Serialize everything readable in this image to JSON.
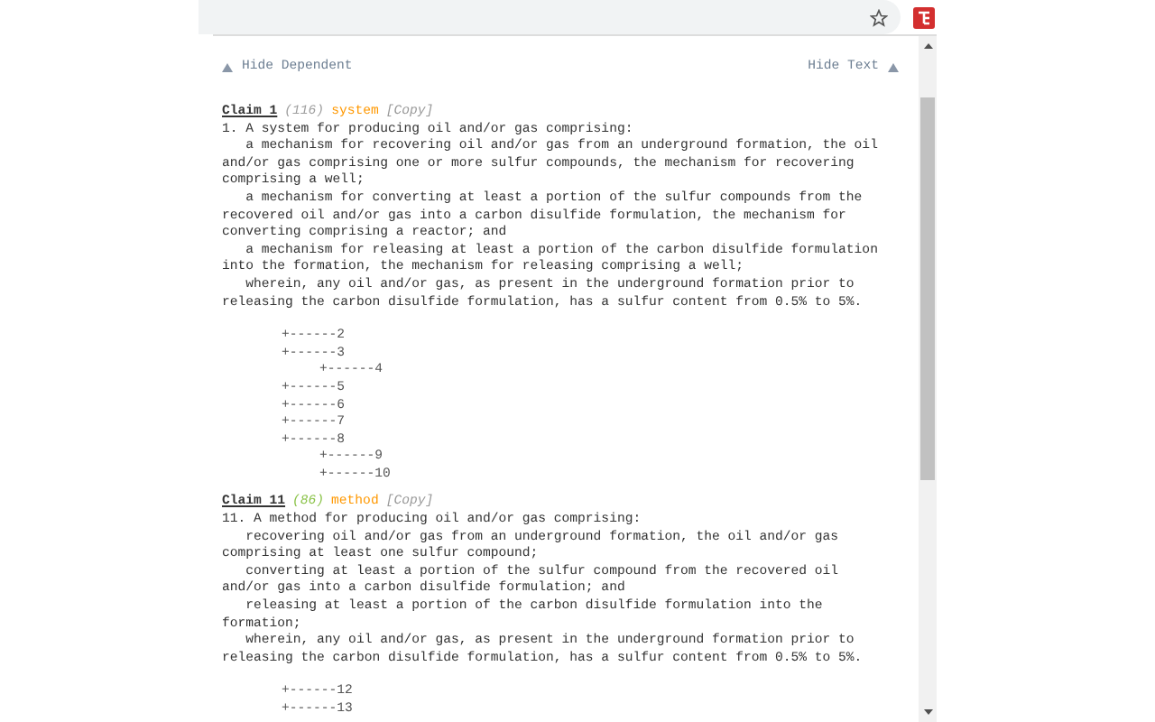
{
  "toolbar": {
    "left_toggle": "Hide Dependent",
    "right_toggle": "Hide Text"
  },
  "claims": [
    {
      "title": "Claim 1",
      "count": "(116)",
      "color": "#9e9e9e",
      "type": "system",
      "copy": "[Copy]",
      "paragraphs": [
        [
          "1. A system for producing oil and/or gas comprising:"
        ],
        [
          "   a mechanism for recovering oil and/or gas from an underground formation, the oil",
          "and/or gas comprising one or more sulfur compounds, the mechanism for recovering",
          "comprising a well;"
        ],
        [
          "   a mechanism for converting at least a portion of the sulfur compounds from the",
          "recovered oil and/or gas into a carbon disulfide formulation, the mechanism for",
          "converting comprising a reactor; and"
        ],
        [
          "   a mechanism for releasing at least a portion of the carbon disulfide formulation",
          "into the formation, the mechanism for releasing comprising a well;"
        ],
        [
          "   wherein, any oil and/or gas, as present in the underground formation prior to",
          "releasing the carbon disulfide formulation, has a sulfur content from 0.5% to 5%."
        ]
      ],
      "tree": [
        {
          "label": "+------2"
        },
        {
          "label": "+------3",
          "children": [
            {
              "label": "+------4"
            }
          ]
        },
        {
          "label": "+------5"
        },
        {
          "label": "+------6"
        },
        {
          "label": "+------7"
        },
        {
          "label": "+------8",
          "children": [
            {
              "label": "+------9"
            },
            {
              "label": "+------10"
            }
          ]
        }
      ]
    },
    {
      "title": "Claim 11",
      "count": "(86)",
      "color": "#8bc34a",
      "type": "method",
      "copy": "[Copy]",
      "paragraphs": [
        [
          "11. A method for producing oil and/or gas comprising:"
        ],
        [
          "   recovering oil and/or gas from an underground formation, the oil and/or gas",
          "comprising at least one sulfur compound;"
        ],
        [
          "   converting at least a portion of the sulfur compound from the recovered oil",
          "and/or gas into a carbon disulfide formulation; and"
        ],
        [
          "   releasing at least a portion of the carbon disulfide formulation into the",
          "formation;"
        ],
        [
          "   wherein, any oil and/or gas, as present in the underground formation prior to",
          "releasing the carbon disulfide formulation, has a sulfur content from 0.5% to 5%."
        ]
      ],
      "tree": [
        {
          "label": "+------12"
        },
        {
          "label": "+------13"
        }
      ]
    }
  ]
}
